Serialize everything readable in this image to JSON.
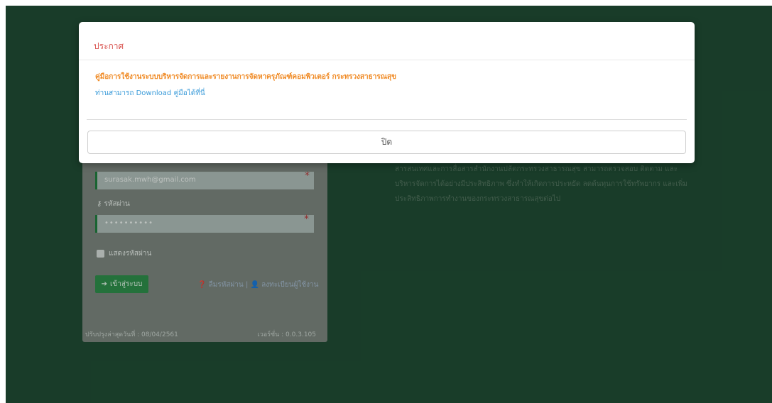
{
  "modal": {
    "title": "ประกาศ",
    "headline": "คู่มือการใช้งานระบบบริหารจัดการและรายงานการจัดหาครุภัณฑ์คอมพิวเตอร์ กระทรวงสาธารณสุข",
    "download_link": "ท่านสามารถ Download คู่มือได้ที่นี่",
    "close_label": "ปิด"
  },
  "login": {
    "email_value": "surasak.mwh@gmail.com",
    "password_label": "รหัสผ่าน",
    "password_value": "••••••••••",
    "show_password_label": "แสดงรหัสผ่าน",
    "login_button": "เข้าสู่ระบบ",
    "forgot_password": "ลืมรหัสผ่าน",
    "separator": "|",
    "register": "ลงทะเบียนผู้ใช้งาน",
    "last_update": "ปรับปรุงล่าสุดวันที่ : 08/04/2561",
    "version": "เวอร์ชั่น : 0.0.3.105"
  },
  "description": "สารสนเทศและการสื่อสารสำนักงานปลัดกระทรวงสาธารณสุข สามารถตรวจสอบ ติดตาม และบริหารจัดการได้อย่างมีประสิทธิภาพ ซึ่งทำให้เกิดการประหยัด ลดต้นทุนการใช้ทรัพยากร และเพิ่มประสิทธิภาพการทำงานของกระทรวงสาธารณสุขต่อไป",
  "colors": {
    "background": "#1f4a32",
    "modal_title": "#d9534f",
    "headline": "#f08a24",
    "link": "#3a9bd9",
    "login_button": "#2c8a49"
  }
}
